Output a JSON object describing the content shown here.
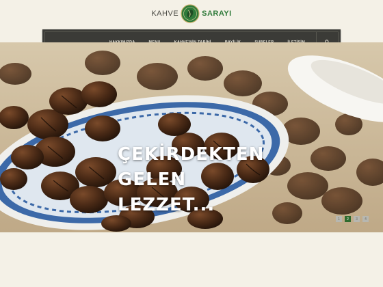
{
  "brand": {
    "left": "KAHVE",
    "right": "SARAYI"
  },
  "nav": {
    "items": [
      "HAKKIMIZDA",
      "MENU",
      "KAHVE'NİN TARİHİ",
      "BAYİLİK",
      "ŞUBELER",
      "İLETİŞİM"
    ],
    "search_icon": "search-icon"
  },
  "hero": {
    "headline_lines": [
      "ÇEKİRDEKTEN",
      "GELEN",
      "LEZZET..."
    ]
  },
  "slider": {
    "dots": [
      "1",
      "2",
      "3",
      "4"
    ],
    "active_index": 1
  },
  "colors": {
    "nav_bg": "#3b3b37",
    "brand_green": "#2f7a3a",
    "page_bg": "#f4f1e7",
    "active_dot": "#2f6b2e"
  }
}
